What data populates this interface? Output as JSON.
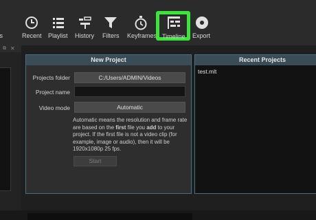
{
  "toolbar": {
    "items": [
      {
        "label": "Properties",
        "icon": "info-icon"
      },
      {
        "label": "Recent",
        "icon": "clock-icon"
      },
      {
        "label": "Playlist",
        "icon": "list-icon"
      },
      {
        "label": "History",
        "icon": "history-icon"
      },
      {
        "label": "Filters",
        "icon": "funnel-icon"
      },
      {
        "label": "Keyframes",
        "icon": "stopwatch-icon"
      },
      {
        "label": "Timeline",
        "icon": "timeline-icon"
      },
      {
        "label": "Export",
        "icon": "disc-icon"
      }
    ],
    "visible_properties_text": "erties",
    "highlight_color": "#39e639"
  },
  "new_project": {
    "title": "New Project",
    "projects_folder_label": "Projects folder",
    "projects_folder_value": "C:/Users/ADMIN/Videos",
    "project_name_label": "Project name",
    "project_name_value": "",
    "video_mode_label": "Video mode",
    "video_mode_value": "Automatic",
    "help_parts": [
      "Automatic means the resolution and frame rate are based on the ",
      "first",
      " file you ",
      "add",
      " to your project. If the first file is not a video clip (for example, image or audio), then it will be 1920x1080p 25 fps."
    ],
    "start_label": "Start"
  },
  "recent_projects": {
    "title": "Recent Projects",
    "items": [
      "test.mlt"
    ]
  }
}
